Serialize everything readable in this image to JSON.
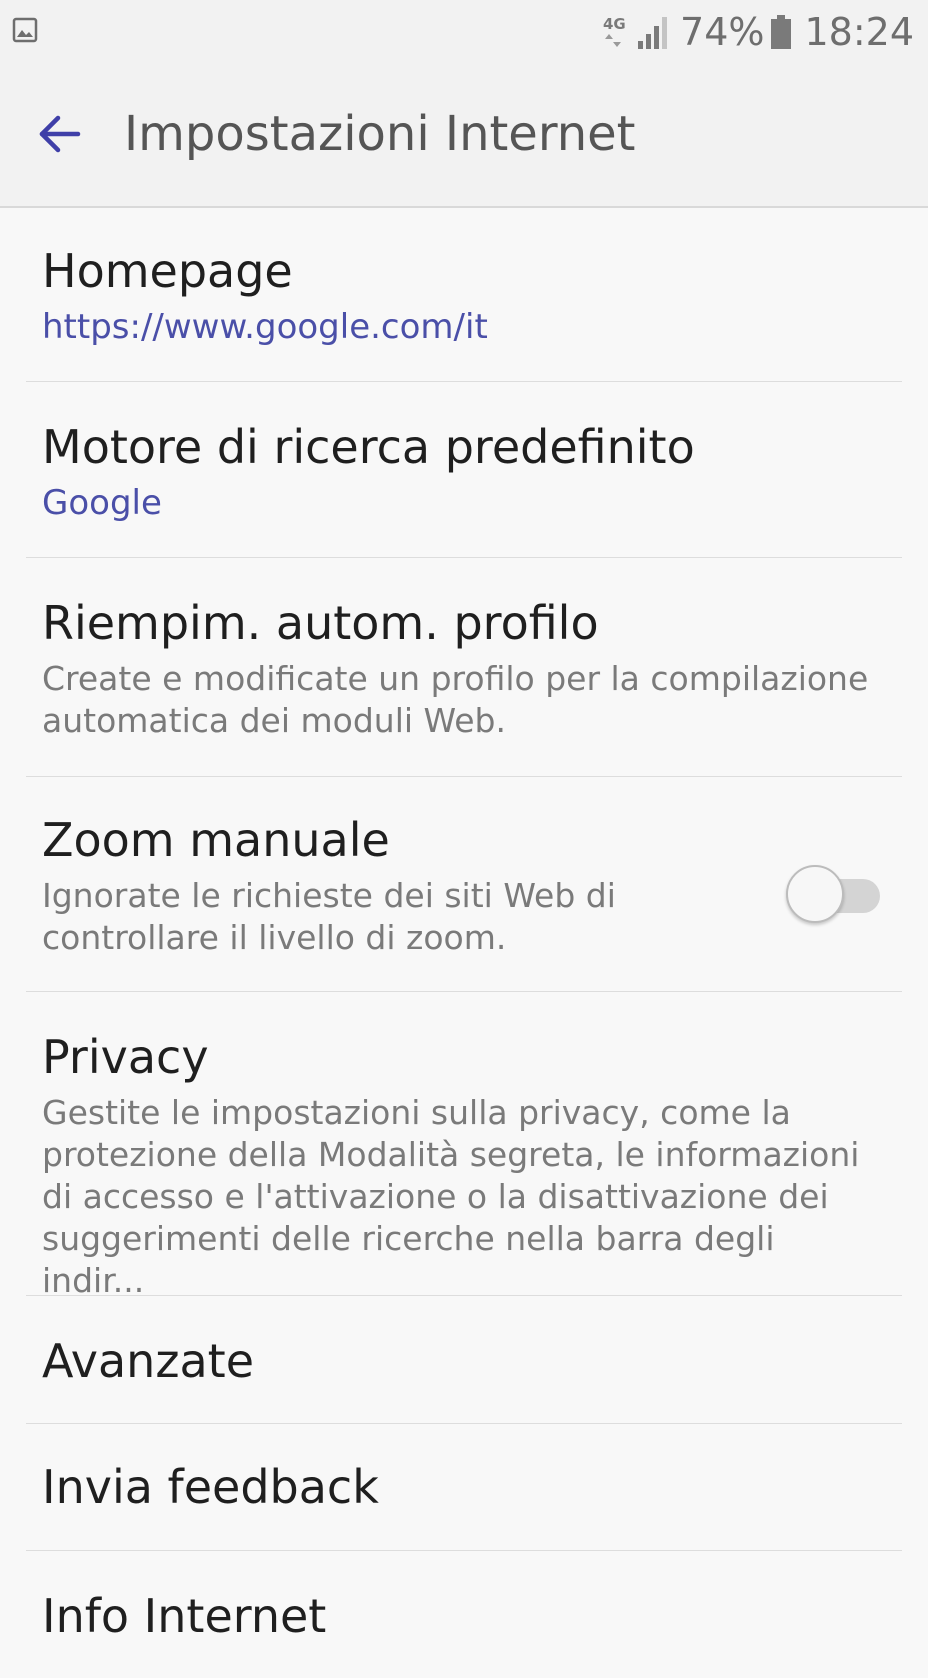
{
  "status_bar": {
    "left_icon": "gallery-icon",
    "network": "4G",
    "battery_percent": "74%",
    "time": "18:24"
  },
  "app_bar": {
    "title": "Impostazioni Internet",
    "back_icon": "arrow-left-icon",
    "accent_color": "#3f3fa8"
  },
  "settings": {
    "homepage": {
      "title": "Homepage",
      "value": "https://www.google.com/it"
    },
    "search_engine": {
      "title": "Motore di ricerca predefinito",
      "value": "Google"
    },
    "autofill": {
      "title": "Riempim. autom. profilo",
      "description_line1": "Create e modificate un profilo per la compilazione",
      "description_line2": "automatica dei moduli Web."
    },
    "manual_zoom": {
      "title": "Zoom manuale",
      "description_line1": "Ignorate le richieste dei siti Web di",
      "description_line2": "controllare il livello di zoom.",
      "enabled": false
    },
    "privacy": {
      "title": "Privacy",
      "description_line1": "Gestite le impostazioni sulla privacy, come la",
      "description_line2": "protezione della Modalità segreta, le informazioni",
      "description_line3": "di accesso e l'attivazione o la disattivazione dei",
      "description_line4": "suggerimenti delle ricerche nella barra degli indir..."
    },
    "advanced": {
      "title": "Avanzate"
    },
    "feedback": {
      "title": "Invia feedback"
    },
    "about": {
      "title": "Info Internet"
    }
  }
}
